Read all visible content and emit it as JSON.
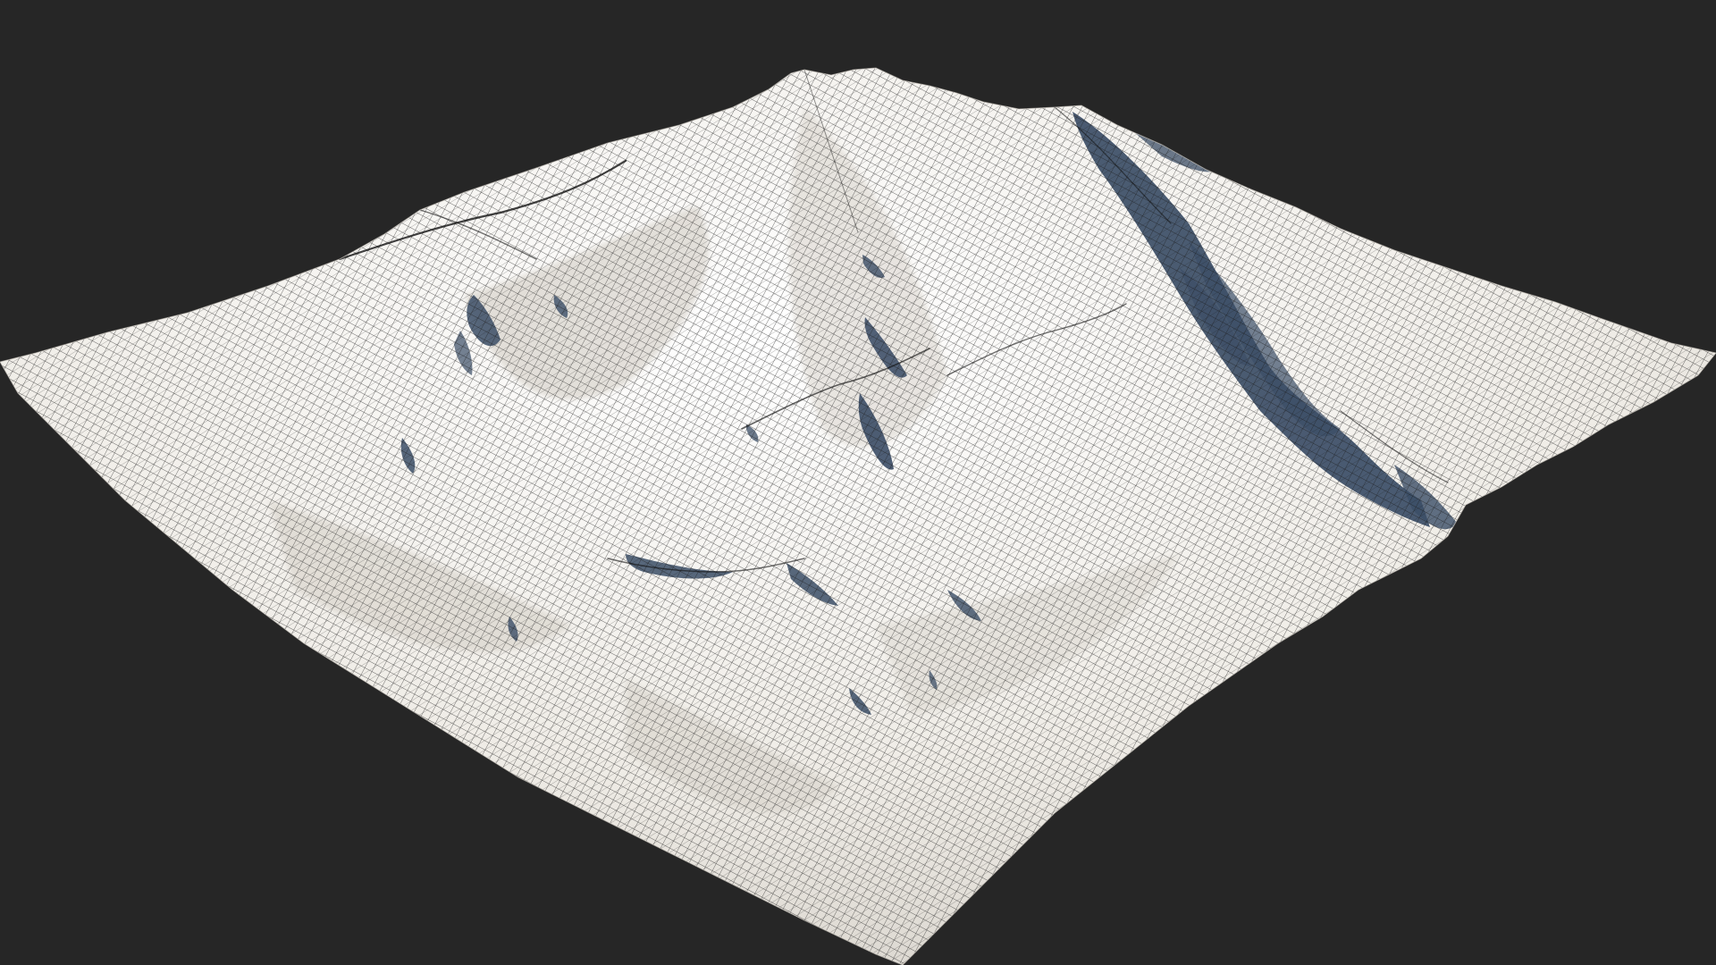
{
  "scene": {
    "subject": "wireframe-terrain-mesh",
    "background_color": "#262626",
    "surface_color": "#f2efea",
    "wire_color": "#1a1a1a",
    "shadow_color": "#3b4d66",
    "light_direction": "upper-left"
  }
}
